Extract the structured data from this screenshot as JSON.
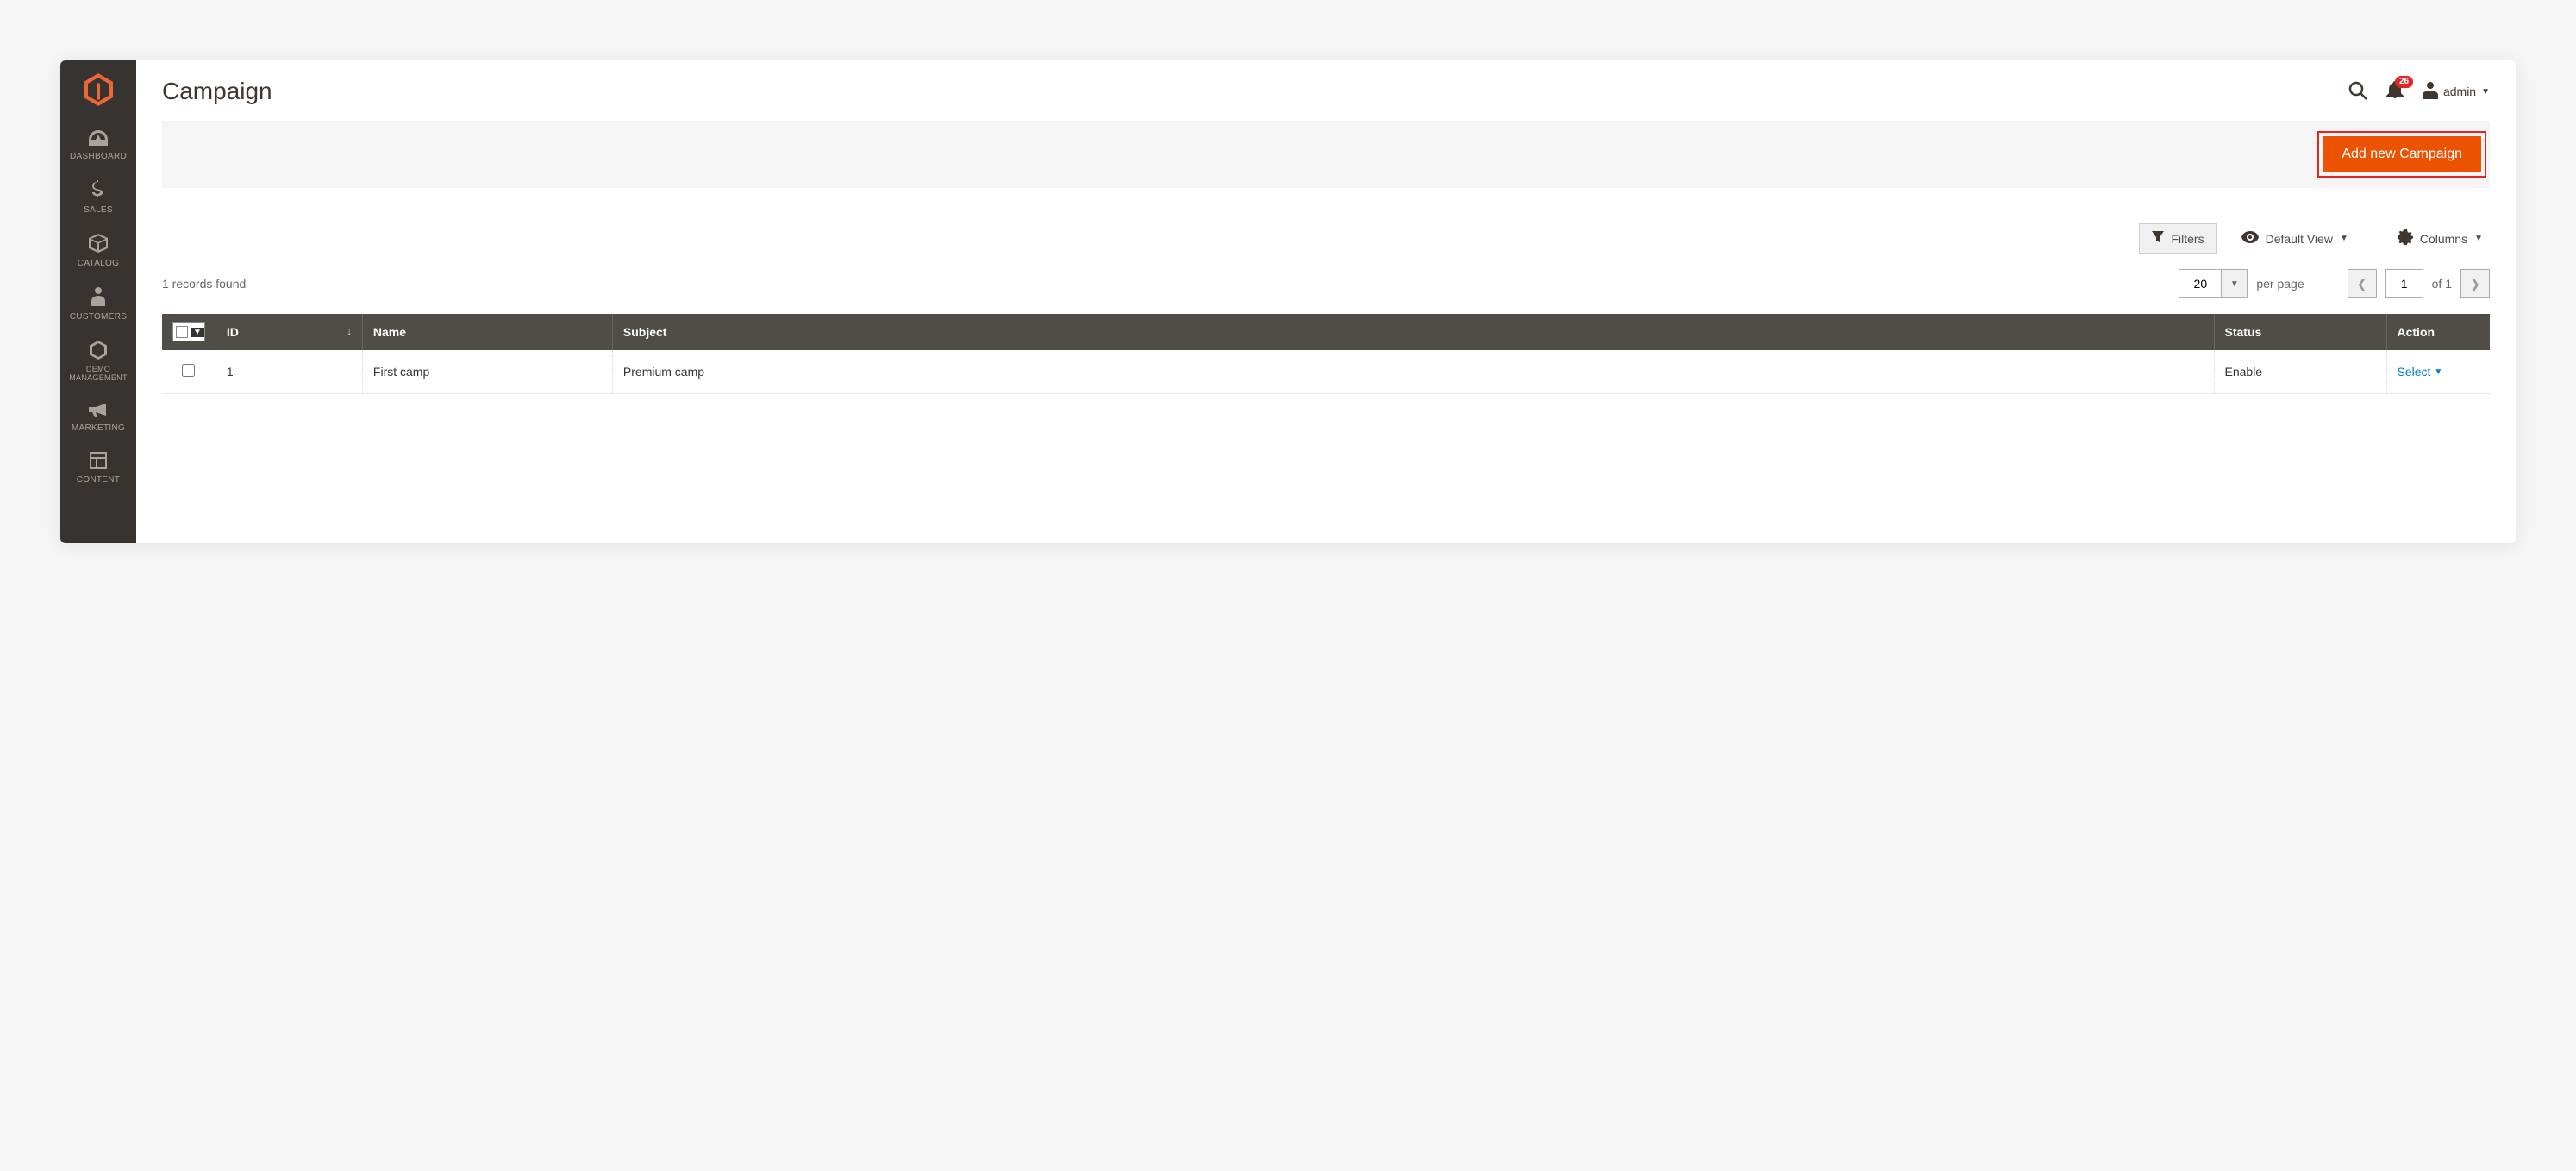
{
  "sidebar": {
    "items": [
      {
        "label": "DASHBOARD",
        "icon": "gauge"
      },
      {
        "label": "SALES",
        "icon": "dollar"
      },
      {
        "label": "CATALOG",
        "icon": "box"
      },
      {
        "label": "CUSTOMERS",
        "icon": "person"
      },
      {
        "label": "DEMO MANAGEMENT",
        "icon": "hex"
      },
      {
        "label": "MARKETING",
        "icon": "megaphone"
      },
      {
        "label": "CONTENT",
        "icon": "layout"
      }
    ]
  },
  "header": {
    "title": "Campaign",
    "notifications": "26",
    "user": "admin"
  },
  "actions": {
    "add_label": "Add new Campaign"
  },
  "toolbar": {
    "filters": "Filters",
    "view": "Default View",
    "columns": "Columns"
  },
  "grid": {
    "records_found": "1 records found",
    "page_size": "20",
    "per_page": "per page",
    "current_page": "1",
    "of_label": "of",
    "total_pages": "1",
    "columns": [
      "ID",
      "Name",
      "Subject",
      "Status",
      "Action"
    ],
    "rows": [
      {
        "id": "1",
        "name": "First camp",
        "subject": "Premium camp",
        "status": "Enable",
        "action": "Select"
      }
    ]
  }
}
